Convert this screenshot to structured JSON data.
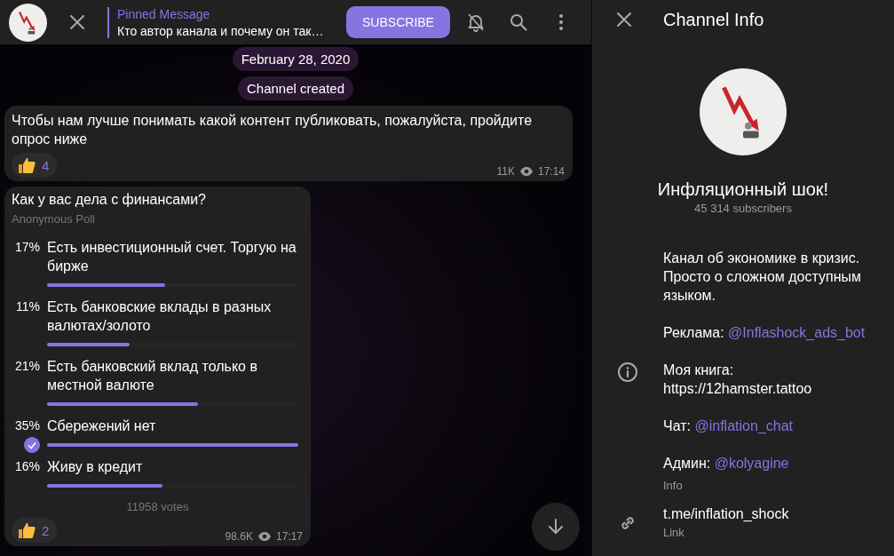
{
  "header": {
    "pinned_title": "Pinned Message",
    "pinned_text": "Кто автор канала и почему он так…",
    "subscribe": "SUBSCRIBE"
  },
  "service_messages": [
    "February 28, 2020",
    "Channel created"
  ],
  "messages": [
    {
      "kind": "text",
      "text": "Чтобы нам лучше понимать какой контент публиковать, пожалуйста, пройдите опрос ниже",
      "reaction_count": "4",
      "views": "11K",
      "time": "17:14"
    },
    {
      "kind": "poll",
      "question": "Как у вас дела с финансами?",
      "poll_type": "Anonymous Poll",
      "options": [
        {
          "percent": "17%",
          "text": "Есть инвестиционный счет. Торгую на бирже",
          "level": 0.47,
          "selected": false
        },
        {
          "percent": "11%",
          "text": "Есть банковские вклады в разных валютах/золото",
          "level": 0.33,
          "selected": false
        },
        {
          "percent": "21%",
          "text": "Есть банковский вклад только в местной валюте",
          "level": 0.6,
          "selected": false
        },
        {
          "percent": "35%",
          "text": "Сбережений нет",
          "level": 1.0,
          "selected": true
        },
        {
          "percent": "16%",
          "text": "Живу в кредит",
          "level": 0.46,
          "selected": false
        }
      ],
      "votes": "11958 votes",
      "reaction_count": "2",
      "views": "98.6K",
      "time": "17:17"
    }
  ],
  "info_panel": {
    "title": "Channel Info",
    "name": "Инфляционный шок!",
    "subscribers": "45 314 subscribers",
    "description": [
      {
        "text": "Канал об экономике в кризис. Просто о сложном доступным языком."
      },
      {
        "text": "Реклама: ",
        "link": "@Inflashock_ads_bot"
      },
      {
        "text": "Моя книга: https://12hamster.tattoo"
      },
      {
        "text": "Чат: ",
        "link": "@inflation_chat"
      },
      {
        "text": "Админ: ",
        "link": "@kolyagine"
      }
    ],
    "description_label": "Info",
    "link": "t.me/inflation_shock",
    "link_label": "Link"
  }
}
